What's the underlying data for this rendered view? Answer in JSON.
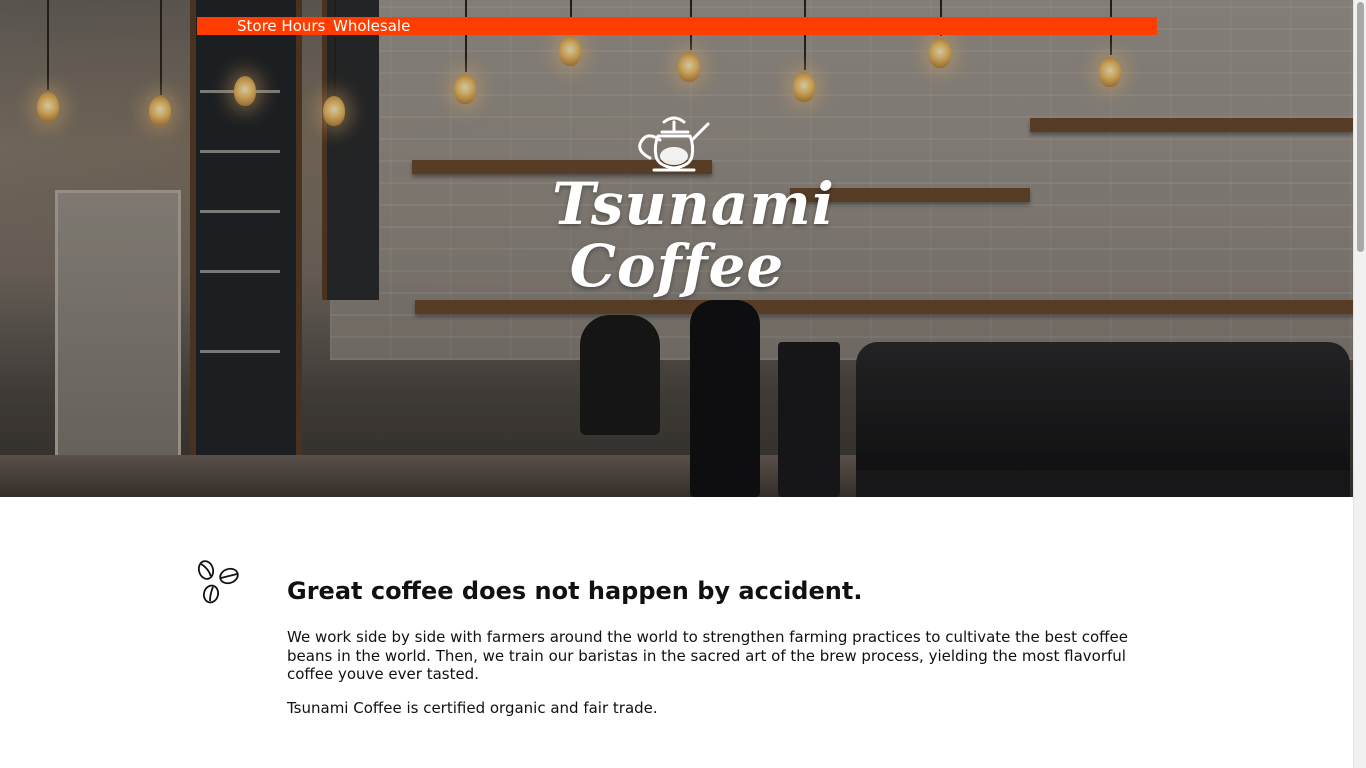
{
  "nav": {
    "store_hours": "Store Hours",
    "wholesale": "Wholesale",
    "bar_color": "#ff3d00"
  },
  "hero": {
    "logo_line1": "Tsunami",
    "logo_line2": "Coffee",
    "logo_icon": "kettle-icon"
  },
  "intro": {
    "icon": "coffee-beans-icon",
    "headline": "Great coffee does not happen by accident.",
    "paragraph1": "We work side by side with farmers around the world to strengthen farming practices to cultivate the best coffee beans in the world. Then, we train our baristas in the sacred art of the brew process, yielding the most flavorful coffee youve ever tasted.",
    "paragraph2": "Tsunami Coffee is certified organic and fair trade."
  }
}
